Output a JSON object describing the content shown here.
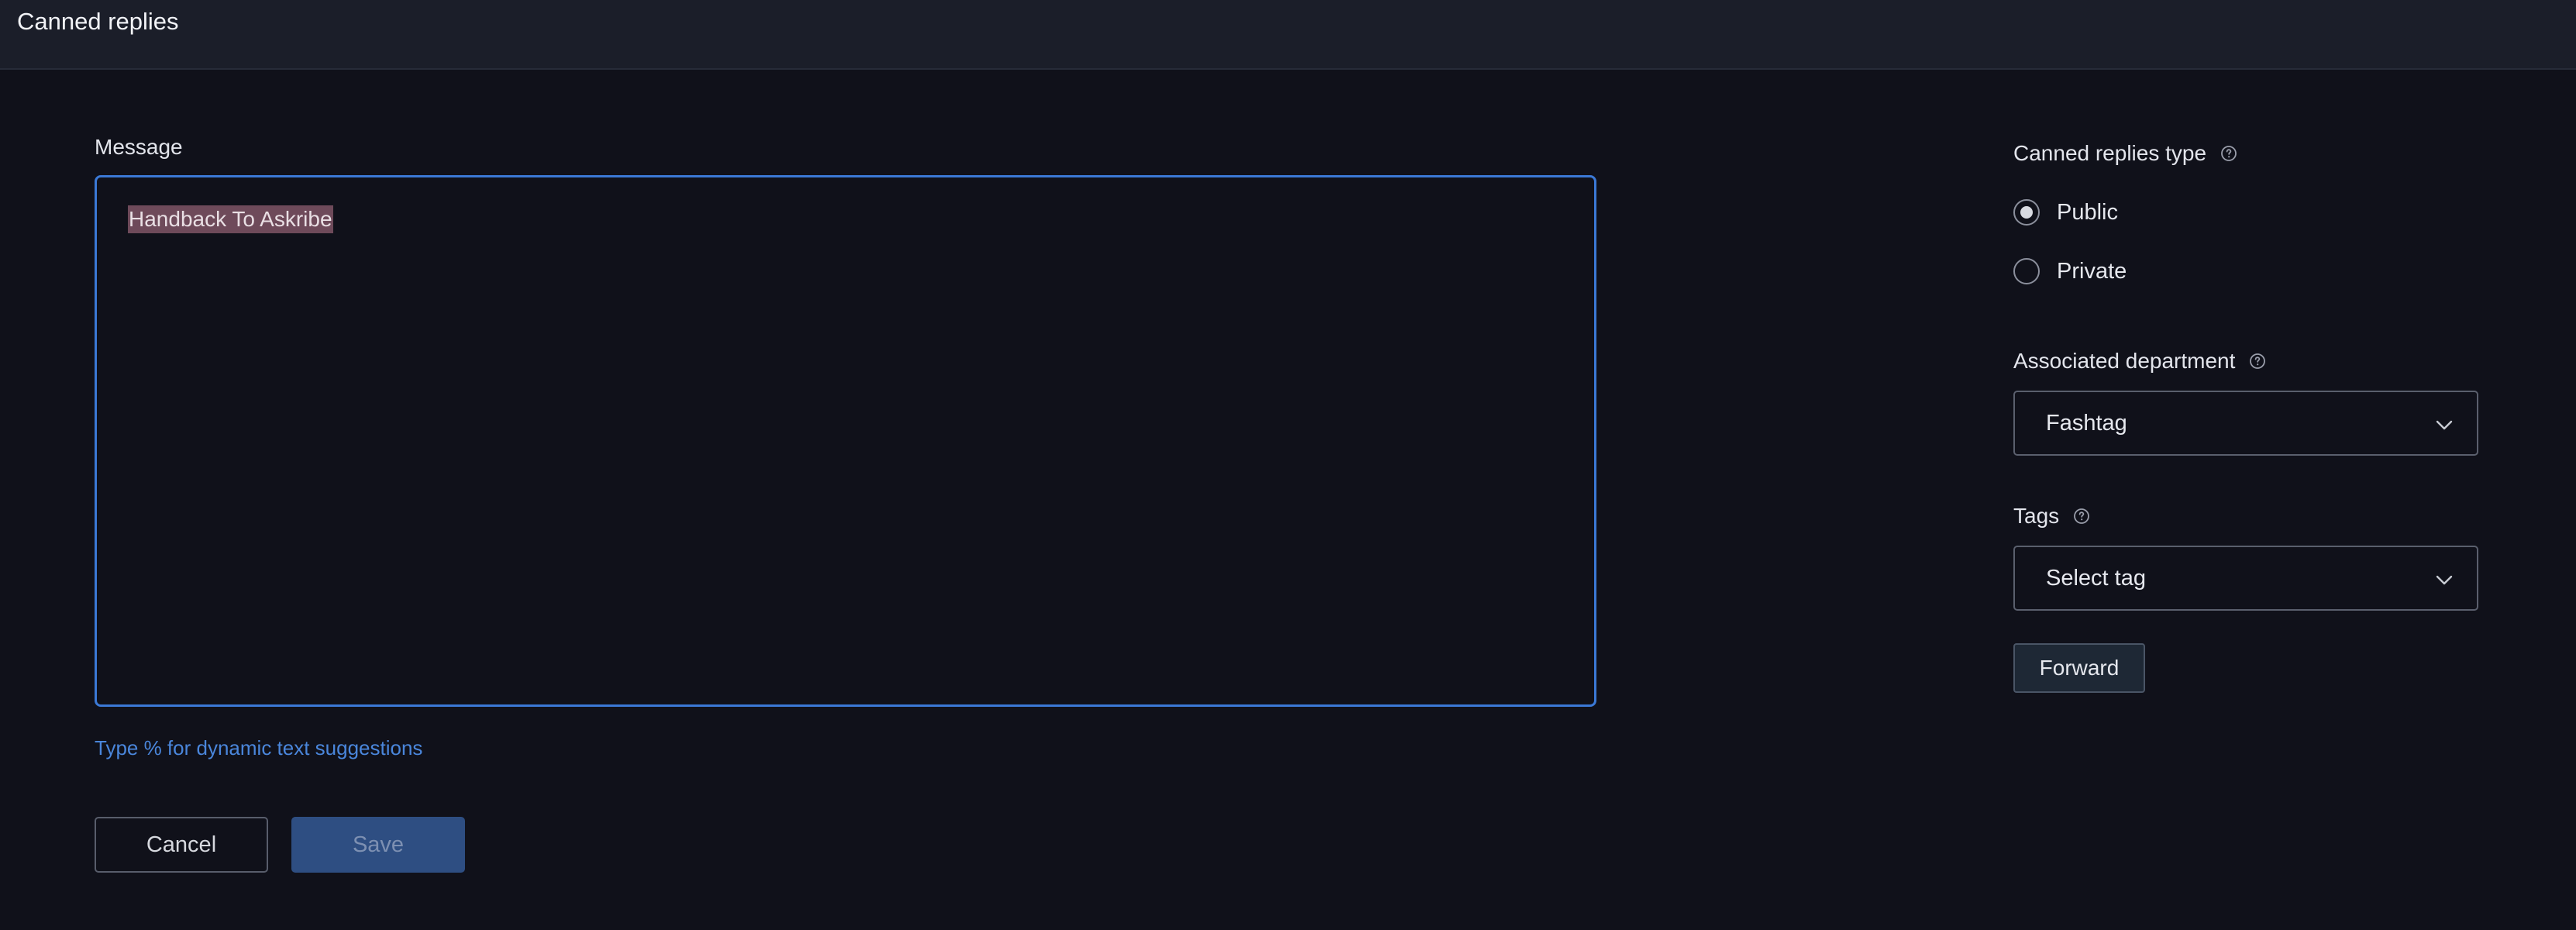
{
  "header": {
    "title": "Canned replies"
  },
  "message": {
    "label": "Message",
    "value": "Handback To Askribe",
    "hint": "Type % for dynamic text suggestions"
  },
  "actions": {
    "cancel_label": "Cancel",
    "save_label": "Save"
  },
  "sidebar": {
    "type_label": "Canned replies type",
    "type_options": [
      {
        "label": "Public",
        "selected": true
      },
      {
        "label": "Private",
        "selected": false
      }
    ],
    "department_label": "Associated department",
    "department_value": "Fashtag",
    "tags_label": "Tags",
    "tags_placeholder": "Select tag",
    "forward_label": "Forward"
  },
  "colors": {
    "background": "#10111a",
    "topbar": "#1b1e29",
    "accent": "#3b79d6",
    "hint": "#4a86db",
    "save_button": "#2e4e82",
    "highlight": "#6e4a5a"
  },
  "icons": {
    "help": "help-circle-icon",
    "chevron": "chevron-down-icon"
  }
}
